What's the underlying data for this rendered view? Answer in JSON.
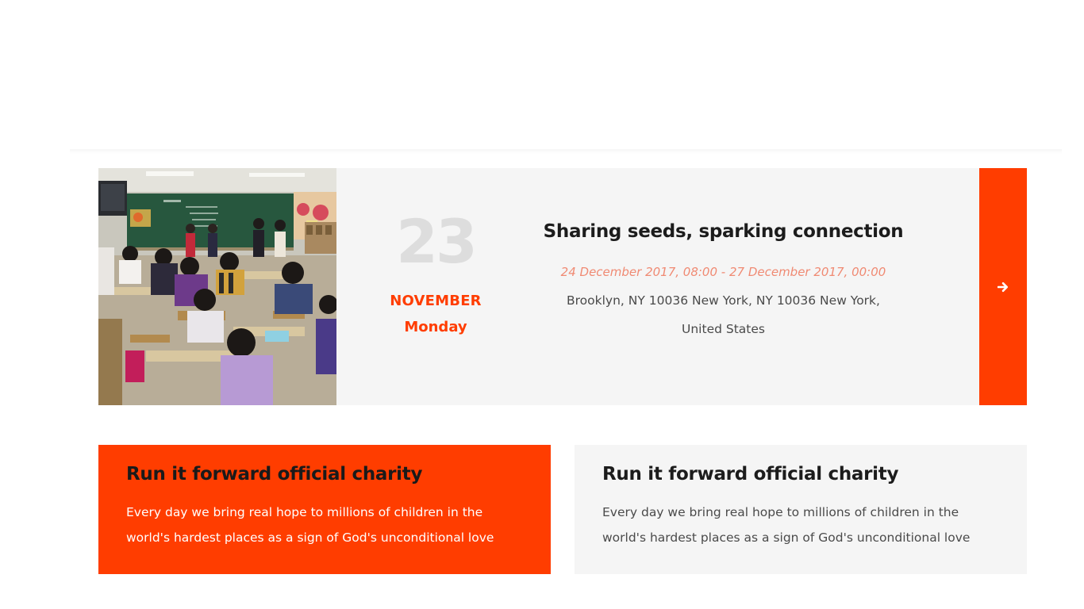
{
  "event": {
    "image_alt": "Classroom with students watching a presentation at the chalkboard",
    "day": "23",
    "month": "NOVEMBER",
    "weekday": "Monday",
    "title": "Sharing seeds, sparking connection",
    "time": "24 December 2017, 08:00 - 27 December 2017, 00:00",
    "address": "Brooklyn, NY 10036 New York, NY 10036 New York, United States",
    "arrow_icon": "arrow-right-icon"
  },
  "cards": [
    {
      "title": "Run it forward official charity",
      "text": "Every day we bring real hope to millions of children in the world's hardest places as a sign of God's unconditional love"
    },
    {
      "title": "Run it forward official charity",
      "text": "Every day we bring real hope to millions of children in the world's hardest places as a sign of God's unconditional love"
    }
  ],
  "colors": {
    "accent": "#ff3d00",
    "card_bg": "#f5f5f5",
    "date_day": "#dddddd",
    "time_text": "#f08a73",
    "heading": "#1c1c1c",
    "body_text": "#4a4a4a"
  }
}
